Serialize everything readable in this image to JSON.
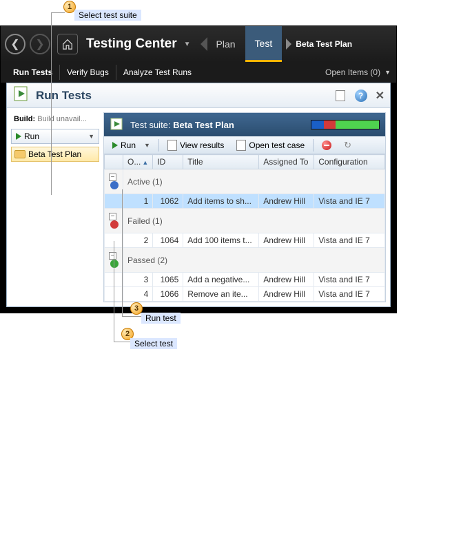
{
  "callouts": {
    "c1": {
      "num": "1",
      "label": "Select test suite"
    },
    "c2": {
      "num": "2",
      "label": "Select test"
    },
    "c3": {
      "num": "3",
      "label": "Run test"
    }
  },
  "app": {
    "title": "Testing Center"
  },
  "breadcrumb": {
    "plan": "Plan",
    "test": "Test",
    "planName": "Beta Test Plan"
  },
  "subnav": {
    "runTests": "Run Tests",
    "verifyBugs": "Verify Bugs",
    "analyze": "Analyze Test Runs",
    "openItems": "Open Items (0)"
  },
  "panel": {
    "title": "Run Tests"
  },
  "sidebar": {
    "buildLabel": "Build:",
    "buildValue": "Build unavail...",
    "runBtn": "Run",
    "suiteName": "Beta Test Plan"
  },
  "main": {
    "suitePrefix": "Test suite:  ",
    "suiteName": "Beta Test Plan",
    "toolbar": {
      "run": "Run",
      "view": "View results",
      "open": "Open test case"
    },
    "cols": {
      "order": "O...",
      "id": "ID",
      "title": "Title",
      "assigned": "Assigned To",
      "config": "Configuration"
    },
    "groups": {
      "active": "Active (1)",
      "failed": "Failed (1)",
      "passed": "Passed (2)"
    },
    "rows": [
      {
        "n": "1",
        "id": "1062",
        "title": "Add items to sh...",
        "asg": "Andrew Hill",
        "cfg": "Vista and IE 7"
      },
      {
        "n": "2",
        "id": "1064",
        "title": "Add 100 items t...",
        "asg": "Andrew Hill",
        "cfg": "Vista and IE 7"
      },
      {
        "n": "3",
        "id": "1065",
        "title": "Add a negative...",
        "asg": "Andrew Hill",
        "cfg": "Vista and IE 7"
      },
      {
        "n": "4",
        "id": "1066",
        "title": "Remove an ite...",
        "asg": "Andrew Hill",
        "cfg": "Vista and IE 7"
      }
    ]
  }
}
